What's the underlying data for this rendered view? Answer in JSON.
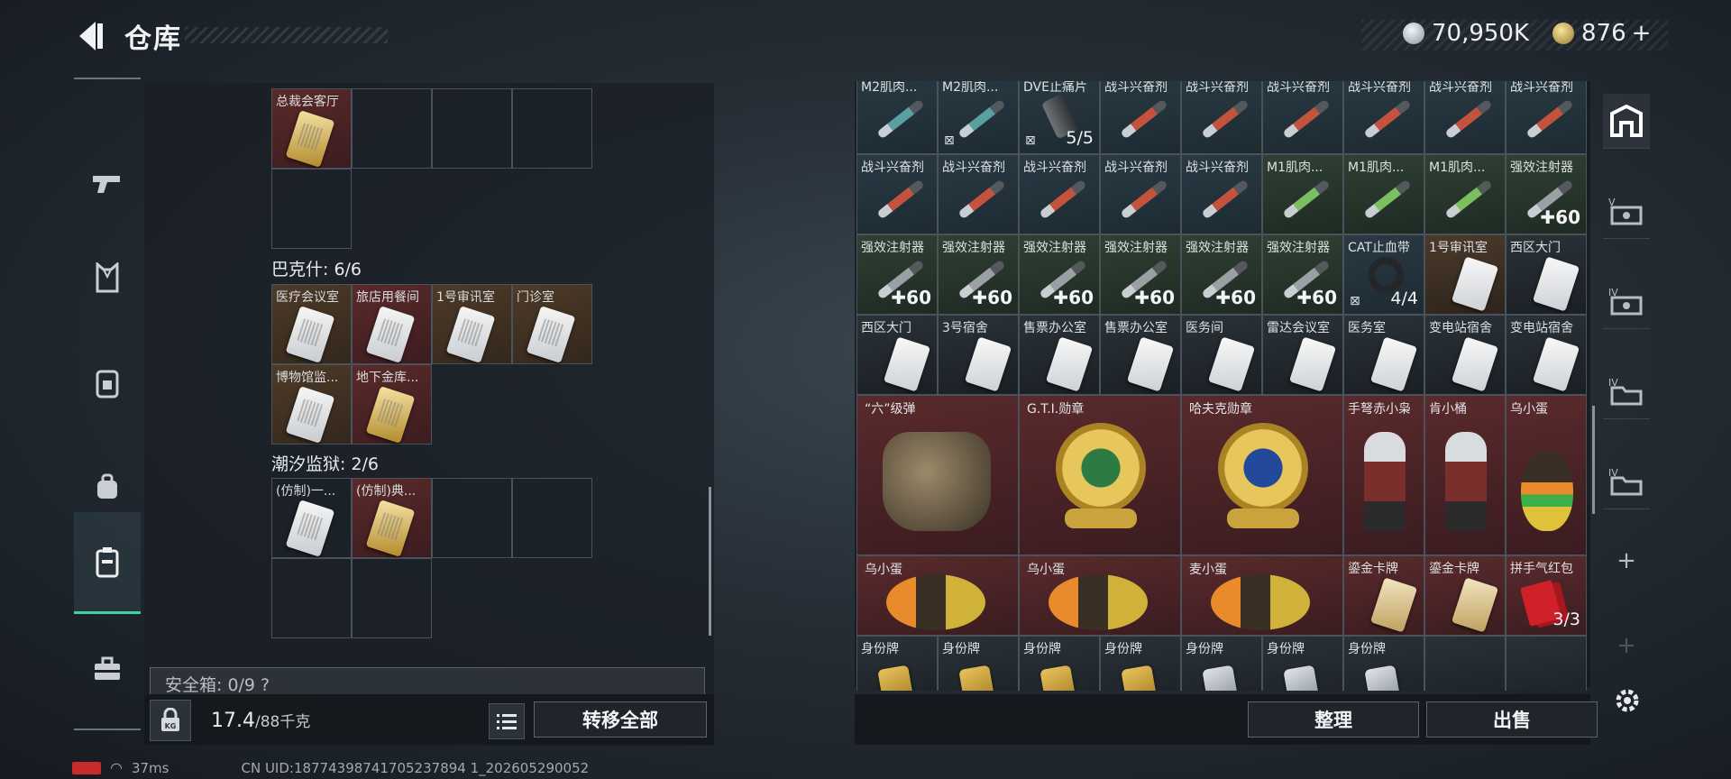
{
  "header": {
    "title": "仓库"
  },
  "currency": {
    "silver": "70,950K",
    "gold": "876",
    "gold_plus": "+"
  },
  "left_nav": [
    "weapons-icon",
    "armor-icon",
    "backpack-icon",
    "bag-icon",
    "storage-icon",
    "toolbox-icon"
  ],
  "left_panel": {
    "top_cells": [
      {
        "label": "总裁会客厅",
        "style": "red",
        "card": "gold"
      }
    ],
    "sections": [
      {
        "title": "巴克什: 6/6",
        "items": [
          {
            "label": "医疗会议室",
            "style": "gold",
            "card": "white"
          },
          {
            "label": "旅店用餐间",
            "style": "red",
            "card": "white"
          },
          {
            "label": "1号审讯室",
            "style": "gold",
            "card": "white"
          },
          {
            "label": "门诊室",
            "style": "gold",
            "card": "white"
          },
          {
            "label": "博物馆监...",
            "style": "gold",
            "card": "white"
          },
          {
            "label": "地下金库...",
            "style": "red",
            "card": "gold"
          }
        ]
      },
      {
        "title": "潮汐监狱: 2/6",
        "items": [
          {
            "label": "(仿制)一...",
            "style": "dark",
            "card": "white"
          },
          {
            "label": "(仿制)典...",
            "style": "red",
            "card": "gold"
          }
        ]
      }
    ],
    "safebox": "安全箱: 0/9 ?",
    "weight": {
      "value": "17.4",
      "capacity": "/88千克"
    },
    "transfer_all": "转移全部"
  },
  "right_grid": {
    "row0": [
      {
        "label": "M2肌肉...",
        "type": "syringe",
        "color": "#5aa0a0"
      },
      {
        "label": "M2肌肉...",
        "type": "syringe",
        "color": "#5aa0a0",
        "noicon": "⊠"
      },
      {
        "label": "DVE止痛片",
        "type": "pill",
        "count": "5/5",
        "noicon": "⊠"
      },
      {
        "label": "战斗兴奋剂",
        "type": "syringe",
        "color": "#c4533e"
      },
      {
        "label": "战斗兴奋剂",
        "type": "syringe",
        "color": "#c4533e"
      },
      {
        "label": "战斗兴奋剂",
        "type": "syringe",
        "color": "#c4533e"
      },
      {
        "label": "战斗兴奋剂",
        "type": "syringe",
        "color": "#c4533e"
      },
      {
        "label": "战斗兴奋剂",
        "type": "syringe",
        "color": "#c4533e"
      },
      {
        "label": "战斗兴奋剂",
        "type": "syringe",
        "color": "#c4533e"
      }
    ],
    "row1": [
      {
        "label": "战斗兴奋剂",
        "type": "syringe",
        "color": "#c4533e"
      },
      {
        "label": "战斗兴奋剂",
        "type": "syringe",
        "color": "#c4533e"
      },
      {
        "label": "战斗兴奋剂",
        "type": "syringe",
        "color": "#c4533e"
      },
      {
        "label": "战斗兴奋剂",
        "type": "syringe",
        "color": "#c4533e"
      },
      {
        "label": "战斗兴奋剂",
        "type": "syringe",
        "color": "#c4533e"
      },
      {
        "label": "M1肌肉...",
        "type": "syringe",
        "color": "#7ac060"
      },
      {
        "label": "M1肌肉...",
        "type": "syringe",
        "color": "#7ac060"
      },
      {
        "label": "M1肌肉...",
        "type": "syringe",
        "color": "#7ac060"
      },
      {
        "label": "强效注射器",
        "type": "syringe",
        "color": "#9aa0a4",
        "bonus": "✚60"
      }
    ],
    "row2": [
      {
        "label": "强效注射器",
        "type": "syringe",
        "color": "#9aa0a4",
        "bonus": "✚60"
      },
      {
        "label": "强效注射器",
        "type": "syringe",
        "color": "#9aa0a4",
        "bonus": "✚60"
      },
      {
        "label": "强效注射器",
        "type": "syringe",
        "color": "#9aa0a4",
        "bonus": "✚60"
      },
      {
        "label": "强效注射器",
        "type": "syringe",
        "color": "#9aa0a4",
        "bonus": "✚60"
      },
      {
        "label": "强效注射器",
        "type": "syringe",
        "color": "#9aa0a4",
        "bonus": "✚60"
      },
      {
        "label": "强效注射器",
        "type": "syringe",
        "color": "#9aa0a4",
        "bonus": "✚60"
      },
      {
        "label": "CAT止血带",
        "type": "tourniquet",
        "count": "4/4",
        "noicon": "⊠"
      },
      {
        "label": "1号审讯室",
        "type": "card",
        "style": "brown"
      },
      {
        "label": "西区大门",
        "type": "card"
      }
    ],
    "row3": [
      {
        "label": "西区大门",
        "type": "card"
      },
      {
        "label": "3号宿舍",
        "type": "card"
      },
      {
        "label": "售票办公室",
        "type": "card"
      },
      {
        "label": "售票办公室",
        "type": "card"
      },
      {
        "label": "医务间",
        "type": "card"
      },
      {
        "label": "雷达会议室",
        "type": "card"
      },
      {
        "label": "医务室",
        "type": "card"
      },
      {
        "label": "变电站宿舍",
        "type": "card"
      },
      {
        "label": "变电站宿舍",
        "type": "card"
      }
    ],
    "big_items": [
      {
        "label": "“六”级弹",
        "icon": "hand-sign"
      },
      {
        "label": "G.T.I.勋章",
        "icon": "medal-green"
      },
      {
        "label": "哈夫克勋章",
        "icon": "medal-blue"
      }
    ],
    "small_red": [
      {
        "label": "手弩赤小枭",
        "icon": "figure"
      },
      {
        "label": "肯小桶",
        "icon": "figure"
      },
      {
        "label": "乌小蛋",
        "icon": "egg"
      }
    ],
    "row6": [
      {
        "label": "乌小蛋",
        "icon": "egg"
      },
      {
        "label": "乌小蛋",
        "icon": "egg"
      },
      {
        "label": "麦小蛋",
        "icon": "egg"
      }
    ],
    "row6_small": [
      {
        "label": "鎏金卡牌",
        "type": "card",
        "style": "red",
        "goldish": true
      },
      {
        "label": "鎏金卡牌",
        "type": "card",
        "style": "red",
        "goldish": true
      },
      {
        "label": "拼手气红包",
        "type": "redpack",
        "count": "3/3",
        "style": "red"
      }
    ],
    "row7": [
      {
        "label": "身份牌",
        "tag": "gold"
      },
      {
        "label": "身份牌",
        "tag": "gold"
      },
      {
        "label": "身份牌",
        "tag": "gold"
      },
      {
        "label": "身份牌",
        "tag": "gold"
      },
      {
        "label": "身份牌",
        "tag": "silver"
      },
      {
        "label": "身份牌",
        "tag": "silver"
      },
      {
        "label": "身份牌",
        "tag": "silver"
      }
    ]
  },
  "right_actions": {
    "sort": "整理",
    "sell": "出售"
  },
  "right_nav": [
    "home-storage-icon",
    "vault-v-icon",
    "vault-iv-icon",
    "vault-iv2-icon",
    "vault-iv3-icon",
    "add-icon",
    "add-disabled-icon"
  ],
  "status": {
    "ping": "37ms",
    "uid": "CN UID:18774398741705237894 1_202605290052"
  }
}
